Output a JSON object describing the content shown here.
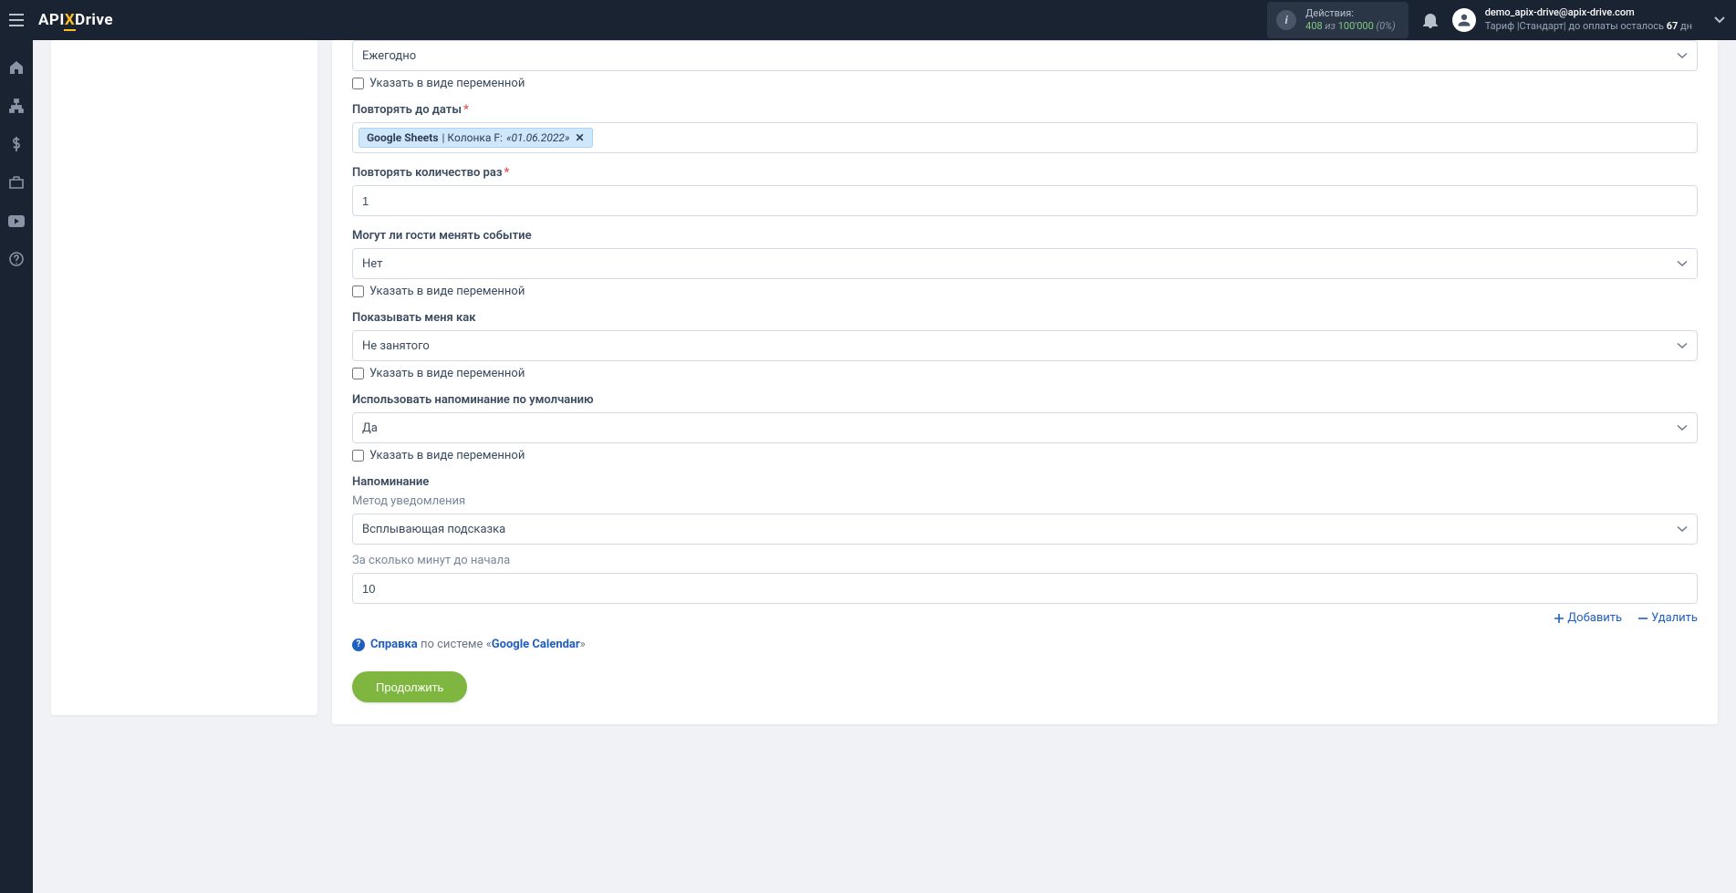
{
  "header": {
    "logo_pre": "API",
    "logo_x": "X",
    "logo_post": "Drive",
    "actions_label": "Действия:",
    "actions_used": "408",
    "actions_sep": "из",
    "actions_total": "100'000",
    "actions_pct": "(0%)",
    "user_email": "demo_apix-drive@apix-drive.com",
    "plan_prefix": "Тариф |Стандарт| до оплаты осталось ",
    "plan_days": "67",
    "plan_suffix": " дн"
  },
  "form": {
    "frequency": {
      "value": "Ежегодно",
      "variable_label": "Указать в виде переменной"
    },
    "repeat_until": {
      "label": "Повторять до даты",
      "pill_source": "Google Sheets",
      "pill_column_prefix": " | Колонка F: ",
      "pill_value": "«01.06.2022»"
    },
    "repeat_count": {
      "label": "Повторять количество раз",
      "value": "1"
    },
    "guests_modify": {
      "label": "Могут ли гости менять событие",
      "value": "Нет",
      "variable_label": "Указать в виде переменной"
    },
    "show_me_as": {
      "label": "Показывать меня как",
      "value": "Не занятого",
      "variable_label": "Указать в виде переменной"
    },
    "default_reminder": {
      "label": "Использовать напоминание по умолчанию",
      "value": "Да",
      "variable_label": "Указать в виде переменной"
    },
    "reminder": {
      "label": "Напоминание",
      "method_label": "Метод уведомления",
      "method_value": "Всплывающая подсказка",
      "minutes_label": "За сколько минут до начала",
      "minutes_value": "10"
    },
    "actions": {
      "add": "Добавить",
      "remove": "Удалить"
    },
    "help": {
      "help_word": "Справка",
      "middle": " по системе «",
      "system": "Google Calendar",
      "suffix": "»"
    },
    "continue_btn": "Продолжить"
  }
}
